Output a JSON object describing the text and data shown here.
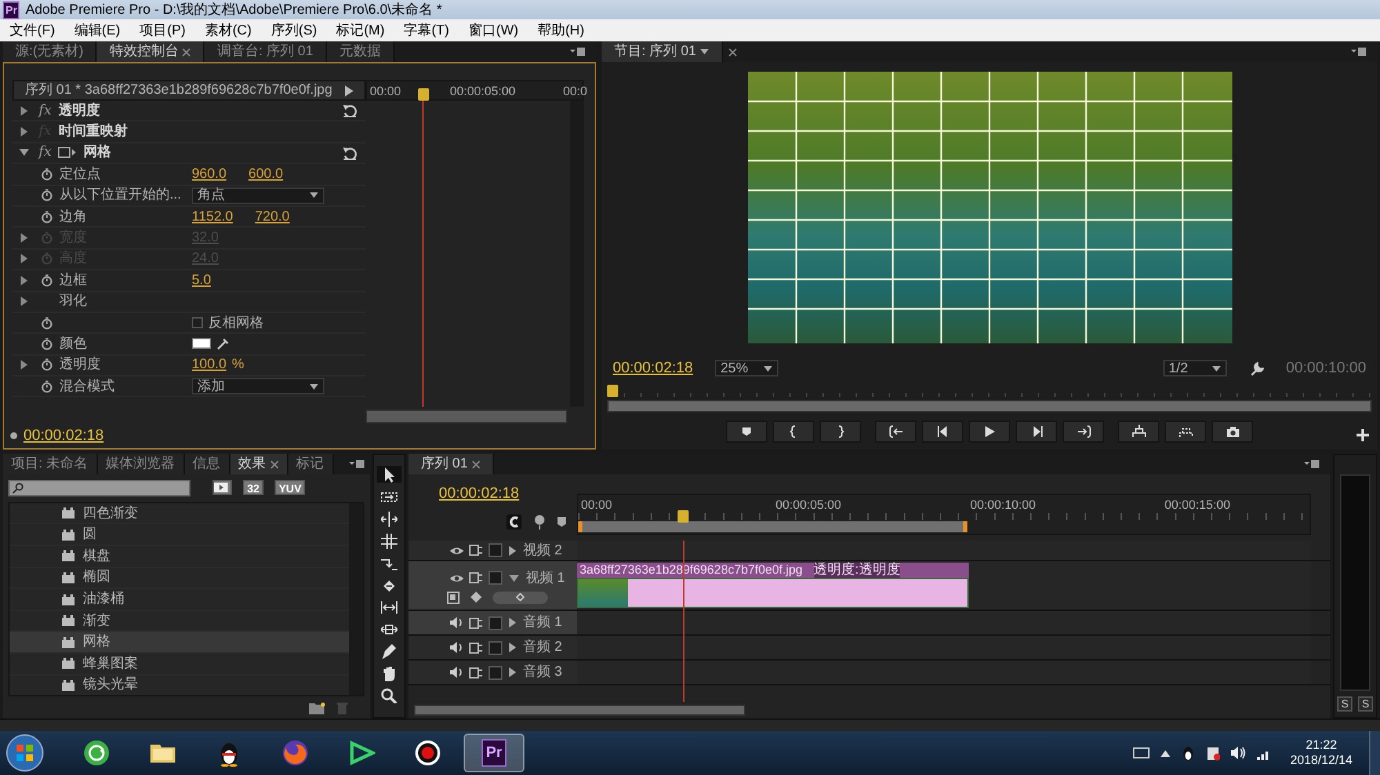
{
  "window": {
    "logo": "Pr",
    "title": "Adobe Premiere Pro - D:\\我的文档\\Adobe\\Premiere Pro\\6.0\\未命名 *"
  },
  "menu": [
    "文件(F)",
    "编辑(E)",
    "项目(P)",
    "素材(C)",
    "序列(S)",
    "标记(M)",
    "字幕(T)",
    "窗口(W)",
    "帮助(H)"
  ],
  "effect_controls": {
    "tabs": [
      {
        "label": "源:(无素材)",
        "selected": false,
        "closable": false
      },
      {
        "label": "特效控制台",
        "selected": true,
        "closable": true
      },
      {
        "label": "调音台: 序列 01",
        "selected": false,
        "closable": false
      },
      {
        "label": "元数据",
        "selected": false,
        "closable": false
      }
    ],
    "clip": "序列 01 * 3a68ff27363e1b289f69628c7b7f0e0f.jpg",
    "ruler_labels": [
      "00:00",
      "00:00:05:00",
      "00:0"
    ],
    "playhead": {
      "level": 0.28
    },
    "rows": [
      {
        "kind": "effect",
        "label": "透明度",
        "fx": "fx",
        "fx_enabled": true,
        "expanded": false,
        "reset": true,
        "mask_icon": false
      },
      {
        "kind": "effect",
        "label": "时间重映射",
        "fx": "fx",
        "fx_enabled": false,
        "expanded": false,
        "reset": false,
        "mask_icon": false
      },
      {
        "kind": "effect",
        "label": "网格",
        "fx": "fx",
        "fx_enabled": true,
        "expanded": true,
        "reset": true,
        "mask_icon": true
      },
      {
        "kind": "param",
        "label": "定位点",
        "values": [
          "960.0",
          "600.0"
        ],
        "expandable": false,
        "disabled": false
      },
      {
        "kind": "dropdown",
        "label": "从以下位置开始的...",
        "value": "角点"
      },
      {
        "kind": "param",
        "label": "边角",
        "values": [
          "1152.0",
          "720.0"
        ],
        "expandable": false,
        "disabled": false
      },
      {
        "kind": "param",
        "label": "宽度",
        "values": [
          "32.0"
        ],
        "expandable": true,
        "disabled": true
      },
      {
        "kind": "param",
        "label": "高度",
        "values": [
          "24.0"
        ],
        "expandable": true,
        "disabled": true
      },
      {
        "kind": "param",
        "label": "边框",
        "values": [
          "5.0"
        ],
        "expandable": true,
        "disabled": false
      },
      {
        "kind": "group",
        "label": "羽化",
        "expandable": true
      },
      {
        "kind": "checkbox",
        "label": "反相网格",
        "checked": false
      },
      {
        "kind": "color",
        "label": "颜色",
        "color": "#ffffff"
      },
      {
        "kind": "param",
        "label": "透明度",
        "values": [
          "100.0"
        ],
        "unit": "%",
        "expandable": true,
        "disabled": false
      },
      {
        "kind": "dropdown",
        "label": "混合模式",
        "value": "添加"
      }
    ],
    "timecode": "00:00:02:18"
  },
  "program_monitor": {
    "tab": "节目: 序列 01",
    "timecode": "00:00:02:18",
    "zoom": "25%",
    "resolution": "1/2",
    "duration": "00:00:10:00",
    "playhead": {
      "level": 0.0
    }
  },
  "effects_panel": {
    "tabs": [
      {
        "label": "项目: 未命名",
        "selected": false,
        "closable": false
      },
      {
        "label": "媒体浏览器",
        "selected": false,
        "closable": false
      },
      {
        "label": "信息",
        "selected": false,
        "closable": false
      },
      {
        "label": "效果",
        "selected": true,
        "closable": true
      },
      {
        "label": "标记",
        "selected": false,
        "closable": false
      }
    ],
    "badges": [
      "32",
      "YUV"
    ],
    "items": [
      {
        "label": "四色渐变",
        "selected": false
      },
      {
        "label": "圆",
        "selected": false
      },
      {
        "label": "棋盘",
        "selected": false
      },
      {
        "label": "椭圆",
        "selected": false
      },
      {
        "label": "油漆桶",
        "selected": false
      },
      {
        "label": "渐变",
        "selected": false
      },
      {
        "label": "网格",
        "selected": true
      },
      {
        "label": "蜂巢图案",
        "selected": false
      },
      {
        "label": "镜头光晕",
        "selected": false
      }
    ]
  },
  "timeline": {
    "tab": "序列 01",
    "timecode": "00:00:02:18",
    "ruler_labels": [
      "00:00",
      "00:00:05:00",
      "00:00:10:00",
      "00:00:15:00"
    ],
    "playhead": {
      "level": 0.144
    },
    "tracks": [
      {
        "kind": "video",
        "label": "视频 2",
        "expanded": false,
        "selected": false
      },
      {
        "kind": "video",
        "label": "视频 1",
        "expanded": true,
        "selected": true,
        "clip": {
          "name": "3a68ff27363e1b289f69628c7b7f0e0f.jpg",
          "effect": "透明度:透明度"
        }
      },
      {
        "kind": "audio",
        "label": "音频 1",
        "expanded": false,
        "selected": true
      },
      {
        "kind": "audio",
        "label": "音频 2",
        "expanded": false,
        "selected": false
      },
      {
        "kind": "audio",
        "label": "音频 3",
        "expanded": false,
        "selected": false
      }
    ]
  },
  "audio_meter": {
    "solo": [
      "S",
      "S"
    ]
  },
  "taskbar": {
    "apps": [
      {
        "kind": "globe",
        "selected": false
      },
      {
        "kind": "folder",
        "selected": false
      },
      {
        "kind": "penguin",
        "selected": false
      },
      {
        "kind": "fox",
        "selected": false
      },
      {
        "kind": "play",
        "selected": false
      },
      {
        "kind": "record",
        "selected": false
      },
      {
        "kind": "tile",
        "label": "Pr",
        "selected": true
      }
    ],
    "time": "21:22",
    "date": "2018/12/14"
  }
}
